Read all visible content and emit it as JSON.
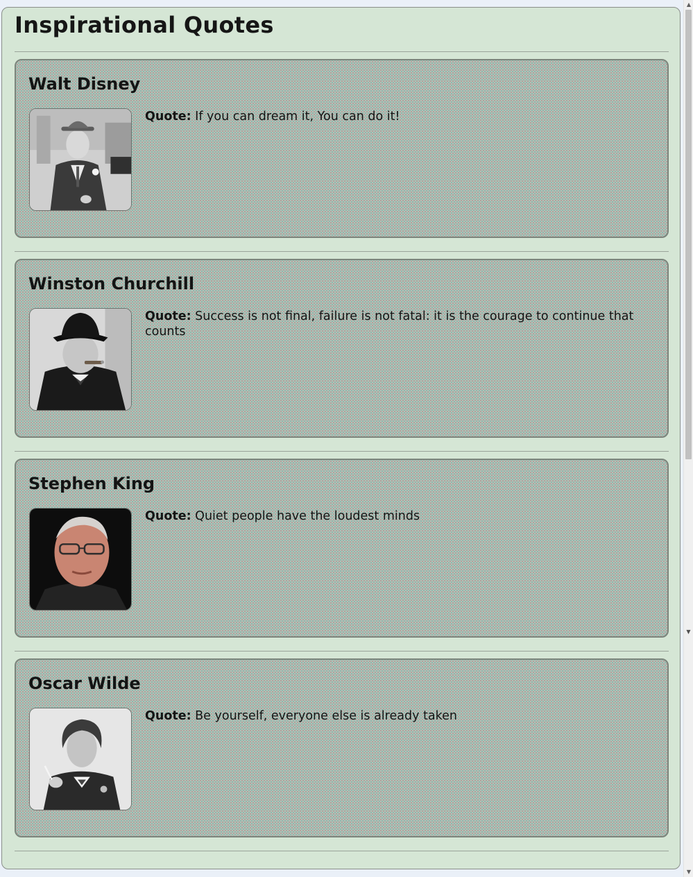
{
  "page": {
    "title": "Inspirational Quotes"
  },
  "quote_prefix": "Quote:",
  "people": [
    {
      "name": "Walt Disney",
      "quote": "If you can dream it, You can do it!",
      "portrait_icon": "walt-disney-portrait"
    },
    {
      "name": "Winston Churchill",
      "quote": "Success is not final, failure is not fatal: it is the courage to continue that counts",
      "portrait_icon": "winston-churchill-portrait"
    },
    {
      "name": "Stephen King",
      "quote": "Quiet people have the loudest minds",
      "portrait_icon": "stephen-king-portrait"
    },
    {
      "name": "Oscar Wilde",
      "quote": "Be yourself, everyone else is already taken",
      "portrait_icon": "oscar-wilde-portrait"
    }
  ],
  "colors": {
    "page_background": "#d5e6d5",
    "card_background": "#b2c2b6",
    "border": "#7c857c"
  }
}
